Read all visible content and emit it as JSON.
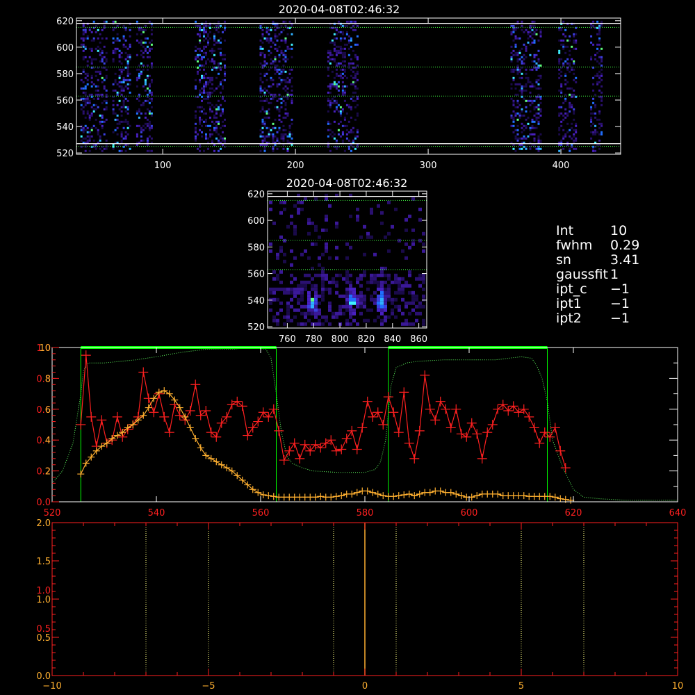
{
  "colors": {
    "white": "#ffffff",
    "green": "#00ff00",
    "red": "#ff2020",
    "orange": "#ffb030",
    "yellow": "#ffff80"
  },
  "info": {
    "rows": [
      {
        "key": "Int",
        "value": "10"
      },
      {
        "key": "fwhm",
        "value": "0.29"
      },
      {
        "key": "sn",
        "value": "3.41"
      },
      {
        "key": "gaussfit",
        "value": "1"
      },
      {
        "key": "ipt_c",
        "value": "−1"
      },
      {
        "key": "ipt1",
        "value": "−1"
      },
      {
        "key": "ipt2",
        "value": "−1"
      }
    ]
  },
  "chart_data": [
    {
      "type": "heatmap",
      "title": "2020-04-08T02:46:32",
      "xlim": [
        35,
        445
      ],
      "ylim": [
        519,
        622
      ],
      "x_ticks": [
        "100",
        "200",
        "300",
        "400"
      ],
      "y_ticks": [
        "520",
        "540",
        "560",
        "580",
        "600",
        "620"
      ],
      "dotted_y": [
        525,
        563,
        585,
        615
      ],
      "solid_y": [
        527,
        618
      ],
      "bands": [
        [
          38,
          58
        ],
        [
          62,
          76
        ],
        [
          80,
          92
        ],
        [
          124,
          146
        ],
        [
          173,
          198
        ],
        [
          224,
          246
        ],
        [
          362,
          385
        ],
        [
          398,
          412
        ],
        [
          422,
          430
        ]
      ]
    },
    {
      "type": "heatmap",
      "title": "2020-04-08T02:46:32",
      "xlim": [
        745,
        866
      ],
      "ylim": [
        519,
        622
      ],
      "x_ticks": [
        "760",
        "780",
        "800",
        "820",
        "840",
        "860"
      ],
      "y_ticks": [
        "520",
        "540",
        "560",
        "580",
        "600",
        "620"
      ],
      "dotted_y": [
        563,
        585,
        615
      ],
      "solid_y": [
        618
      ],
      "hot_spots": [
        [
          778,
          540
        ],
        [
          808,
          540
        ],
        [
          830,
          540
        ]
      ]
    },
    {
      "type": "line",
      "xlim": [
        520,
        640
      ],
      "ylim": [
        0,
        1.0
      ],
      "x_ticks": [
        "520",
        "540",
        "560",
        "580",
        "600",
        "620",
        "640"
      ],
      "y_ticks_left_a": [
        "0.0",
        "0.2",
        "0.4",
        "0.6",
        "0.8",
        "1.0"
      ],
      "y_ticks_left_b": [
        "2",
        "4",
        "6",
        "8",
        "10"
      ],
      "windows": [
        [
          525.5,
          563
        ],
        [
          584.5,
          615
        ]
      ],
      "green_dotted_x": [
        520,
        522,
        524,
        525.5,
        526,
        527,
        528,
        530,
        533,
        536,
        540,
        545,
        550,
        555,
        558,
        561,
        562,
        563,
        564,
        565,
        566,
        568,
        570,
        575,
        580,
        582,
        583,
        584,
        585,
        586,
        588,
        590,
        595,
        600,
        605,
        610,
        612,
        613,
        614,
        615,
        616,
        618,
        620,
        622,
        625,
        630,
        635,
        640
      ],
      "green_dotted_y": [
        0.12,
        0.2,
        0.38,
        0.7,
        0.85,
        0.9,
        0.9,
        0.9,
        0.91,
        0.92,
        0.94,
        0.97,
        0.99,
        0.99,
        1.0,
        0.99,
        0.93,
        0.7,
        0.45,
        0.3,
        0.25,
        0.22,
        0.2,
        0.19,
        0.19,
        0.21,
        0.26,
        0.4,
        0.75,
        0.87,
        0.9,
        0.91,
        0.92,
        0.92,
        0.92,
        0.94,
        0.93,
        0.88,
        0.8,
        0.65,
        0.4,
        0.22,
        0.08,
        0.03,
        0.02,
        0.01,
        0.01,
        0.01
      ],
      "series": [
        {
          "x": [
            525.5,
            526.5,
            527.5,
            528.5,
            529.5,
            530.5,
            531.5,
            532.5,
            533.5,
            534.5,
            535.5,
            536.5,
            537.5,
            538.5,
            539.5,
            540.5,
            541.5,
            542.5,
            543.5,
            544.5,
            545.5,
            546.5,
            547.5,
            548.5,
            549.5,
            550.5,
            551.5,
            552.5,
            553.5,
            554.5,
            555.5,
            556.5,
            557.5,
            558.5,
            559.5,
            560.5,
            561.5,
            562.5,
            563.5,
            564.5,
            565.5,
            566.5,
            567.5,
            568.5,
            569.5,
            570.5,
            571.5,
            572.5,
            573.5,
            574.5,
            575.5,
            576.5,
            577.5,
            578.5,
            579.5,
            580.5,
            581.5,
            582.5,
            583.5,
            584.5,
            585.5,
            586.5,
            587.5,
            588.5,
            589.5,
            590.5,
            591.5,
            592.5,
            593.5,
            594.5,
            595.5,
            596.5,
            597.5,
            598.5,
            599.5,
            600.5,
            601.5,
            602.5,
            603.5,
            604.5,
            605.5,
            606.5,
            607.5,
            608.5,
            609.5,
            610.5,
            611.5,
            612.5,
            613.5,
            614.5,
            615.5,
            616.5,
            617.5,
            618.5
          ],
          "values": [
            0.5,
            0.95,
            0.55,
            0.36,
            0.53,
            0.38,
            0.4,
            0.55,
            0.42,
            0.47,
            0.5,
            0.55,
            0.84,
            0.67,
            0.58,
            0.7,
            0.55,
            0.45,
            0.63,
            0.56,
            0.53,
            0.59,
            0.76,
            0.56,
            0.59,
            0.45,
            0.42,
            0.51,
            0.55,
            0.63,
            0.65,
            0.62,
            0.43,
            0.48,
            0.52,
            0.58,
            0.55,
            0.6,
            0.46,
            0.27,
            0.33,
            0.38,
            0.28,
            0.37,
            0.33,
            0.37,
            0.35,
            0.38,
            0.4,
            0.33,
            0.34,
            0.41,
            0.46,
            0.34,
            0.48,
            0.65,
            0.55,
            0.58,
            0.5,
            0.68,
            0.58,
            0.45,
            0.71,
            0.38,
            0.28,
            0.46,
            0.82,
            0.6,
            0.53,
            0.65,
            0.6,
            0.48,
            0.6,
            0.44,
            0.42,
            0.51,
            0.44,
            0.28,
            0.45,
            0.5,
            0.6,
            0.63,
            0.59,
            0.62,
            0.58,
            0.6,
            0.55,
            0.48,
            0.38,
            0.45,
            0.42,
            0.48,
            0.33,
            0.22
          ]
        },
        {
          "x": [
            525.5,
            526.5,
            527.5,
            528.5,
            529.5,
            530.5,
            531.5,
            532.5,
            533.5,
            534.5,
            535.5,
            536.5,
            537.5,
            538.5,
            539.5,
            540.5,
            541.5,
            542.5,
            543.5,
            544.5,
            545.5,
            546.5,
            547.5,
            548.5,
            549.5,
            550.5,
            551.5,
            552.5,
            553.5,
            554.5,
            555.5,
            556.5,
            557.5,
            558.5,
            559.5,
            560.5,
            561.5,
            562.5,
            563.5,
            564.5,
            565.5,
            566.5,
            567.5,
            568.5,
            569.5,
            570.5,
            571.5,
            572.5,
            573.5,
            574.5,
            575.5,
            576.5,
            577.5,
            578.5,
            579.5,
            580.5,
            581.5,
            582.5,
            583.5,
            584.5,
            585.5,
            586.5,
            587.5,
            588.5,
            589.5,
            590.5,
            591.5,
            592.5,
            593.5,
            594.5,
            595.5,
            596.5,
            597.5,
            598.5,
            599.5,
            600.5,
            601.5,
            602.5,
            603.5,
            604.5,
            605.5,
            606.5,
            607.5,
            608.5,
            609.5,
            610.5,
            611.5,
            612.5,
            613.5,
            614.5,
            615.5,
            616.5,
            617.5,
            618.5,
            619.5
          ],
          "values": [
            0.18,
            0.25,
            0.29,
            0.33,
            0.36,
            0.38,
            0.41,
            0.43,
            0.45,
            0.48,
            0.5,
            0.53,
            0.56,
            0.61,
            0.67,
            0.71,
            0.72,
            0.7,
            0.66,
            0.61,
            0.55,
            0.48,
            0.41,
            0.35,
            0.3,
            0.28,
            0.26,
            0.24,
            0.22,
            0.2,
            0.17,
            0.14,
            0.11,
            0.08,
            0.06,
            0.045,
            0.04,
            0.035,
            0.03,
            0.03,
            0.03,
            0.03,
            0.03,
            0.03,
            0.03,
            0.03,
            0.035,
            0.03,
            0.03,
            0.035,
            0.04,
            0.05,
            0.05,
            0.06,
            0.07,
            0.07,
            0.06,
            0.05,
            0.04,
            0.035,
            0.035,
            0.04,
            0.045,
            0.05,
            0.04,
            0.05,
            0.06,
            0.06,
            0.07,
            0.07,
            0.06,
            0.06,
            0.05,
            0.04,
            0.03,
            0.03,
            0.04,
            0.05,
            0.05,
            0.05,
            0.05,
            0.04,
            0.04,
            0.04,
            0.04,
            0.04,
            0.035,
            0.035,
            0.035,
            0.035,
            0.035,
            0.03,
            0.02,
            0.015,
            0.01
          ]
        }
      ]
    },
    {
      "type": "line",
      "xlim": [
        -10,
        10
      ],
      "ylim": [
        0,
        2.0
      ],
      "x_ticks": [
        "−10",
        "−5",
        "0",
        "5",
        "10"
      ],
      "y_ticks_left_a": [
        "0.0",
        "0.5",
        "1.0",
        "1.5",
        "2.0"
      ],
      "y_ticks_left_b": [
        "0.5",
        "1.0"
      ],
      "dotted_x": [
        -7,
        -5,
        -1,
        1,
        5,
        7
      ],
      "center_x": 0
    }
  ]
}
